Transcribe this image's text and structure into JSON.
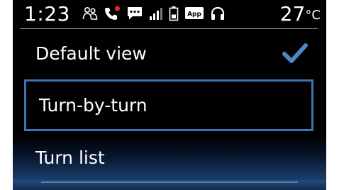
{
  "status_bar": {
    "time": "1:23",
    "temperature": "27",
    "temperature_unit": "°C",
    "app_badge": "App",
    "icons": [
      "people-icon",
      "phone-missed-icon",
      "message-icon",
      "signal-icon",
      "battery-icon",
      "app-icon",
      "headset-icon"
    ]
  },
  "menu": {
    "items": [
      {
        "label": "Default view",
        "selected": true,
        "focused": false
      },
      {
        "label": "Turn-by-turn",
        "selected": false,
        "focused": true
      },
      {
        "label": "Turn list",
        "selected": false,
        "focused": false
      }
    ]
  },
  "colors": {
    "focus_border": "#3d73b0",
    "checkmark": "#4f86c6",
    "missed_call": "#e0262e"
  }
}
